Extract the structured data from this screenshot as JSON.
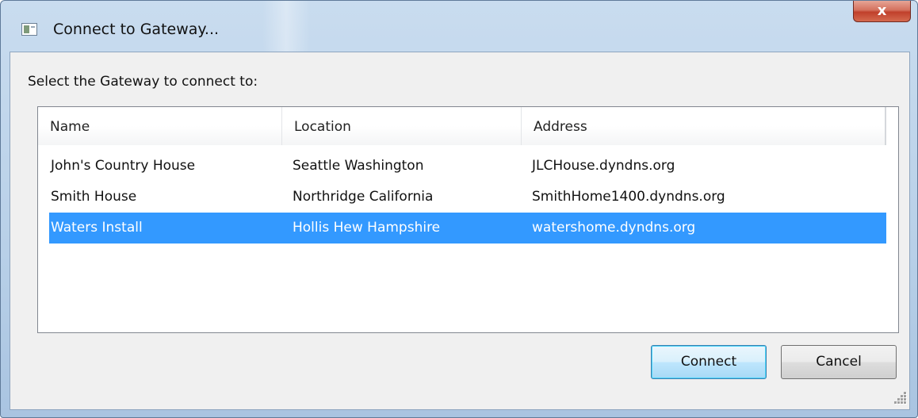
{
  "window": {
    "title": "Connect to Gateway...",
    "close_glyph": "x",
    "app_icon": "app-window-icon"
  },
  "prompt": "Select the Gateway to connect to:",
  "table": {
    "columns": [
      "Name",
      "Location",
      "Address"
    ],
    "rows": [
      {
        "name": "John's Country House",
        "location": "Seattle Washington",
        "address": "JLCHouse.dyndns.org",
        "selected": false
      },
      {
        "name": "Smith House",
        "location": "Northridge California",
        "address": "SmithHome1400.dyndns.org",
        "selected": false
      },
      {
        "name": "Waters Install",
        "location": "Hollis Hew Hampshire",
        "address": "watershome.dyndns.org",
        "selected": true
      }
    ]
  },
  "buttons": {
    "connect": "Connect",
    "cancel": "Cancel"
  },
  "colors": {
    "selection": "#3399ff",
    "close_button": "#c0402b"
  }
}
